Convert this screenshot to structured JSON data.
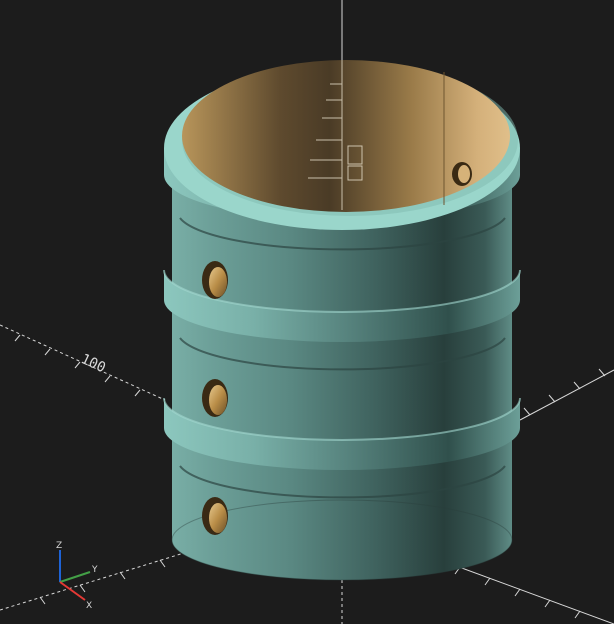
{
  "viewport": {
    "background_color": "#1c1c1c",
    "axis_color": "#d8d8d8",
    "scale_label": "100",
    "axis_labels": {
      "x": "X",
      "y": "Y",
      "z": "Z"
    },
    "axis_colors": {
      "x": "#e53935",
      "y": "#43a047",
      "z": "#1e63d6"
    }
  },
  "model": {
    "name": "barrel",
    "surface_color": "#7fb5ad",
    "interior_color": "#c9a15f",
    "rib_count": 3,
    "hole_count": 4
  }
}
